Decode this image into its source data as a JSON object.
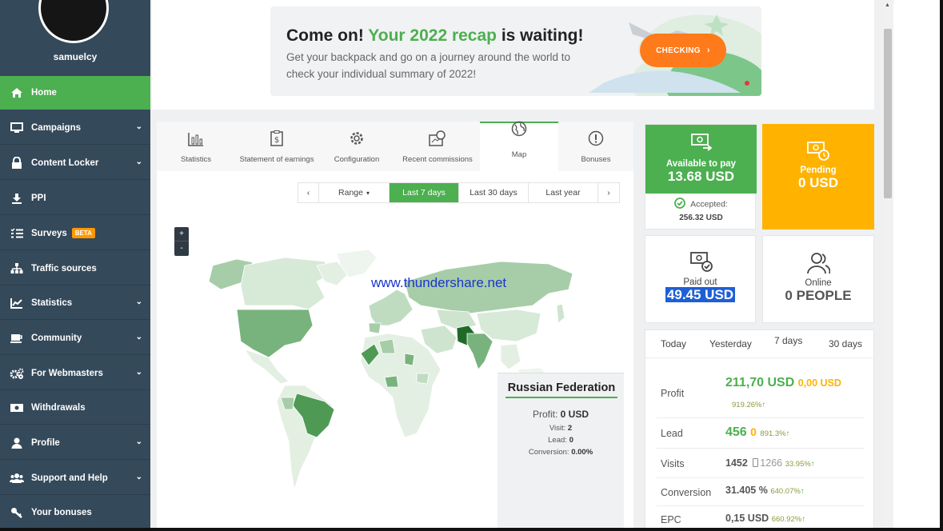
{
  "user": {
    "name": "samuelcy"
  },
  "sidebar": {
    "items": [
      {
        "label": "Home",
        "icon": "home-icon",
        "active": true
      },
      {
        "label": "Campaigns",
        "icon": "monitor-icon",
        "has_submenu": true
      },
      {
        "label": "Content Locker",
        "icon": "lock-icon",
        "has_submenu": true
      },
      {
        "label": "PPI",
        "icon": "download-icon"
      },
      {
        "label": "Surveys",
        "icon": "checklist-icon",
        "badge": "BETA"
      },
      {
        "label": "Traffic sources",
        "icon": "sitemap-icon"
      },
      {
        "label": "Statistics",
        "icon": "line-chart-icon",
        "has_submenu": true
      },
      {
        "label": "Community",
        "icon": "coffee-icon",
        "has_submenu": true
      },
      {
        "label": "For Webmasters",
        "icon": "cogs-icon",
        "has_submenu": true
      },
      {
        "label": "Withdrawals",
        "icon": "money-icon"
      },
      {
        "label": "Profile",
        "icon": "user-icon",
        "has_submenu": true
      },
      {
        "label": "Support and Help",
        "icon": "users-icon",
        "has_submenu": true
      },
      {
        "label": "Your bonuses",
        "icon": "key-icon"
      }
    ]
  },
  "banner": {
    "title_pre": "Come on! ",
    "title_highlight": "Your 2022 recap",
    "title_post": " is waiting!",
    "text": "Get your backpack and go on a journey around the world to check your individual summary of 2022!",
    "button": "CHECKING",
    "button_icon": "chevron-right-icon"
  },
  "tabs": [
    {
      "label": "Statistics",
      "icon": "bar-chart-icon"
    },
    {
      "label": "Statement of earnings",
      "icon": "clipboard-dollar-icon"
    },
    {
      "label": "Configuration",
      "icon": "gear-icon"
    },
    {
      "label": "Recent commissions",
      "icon": "commissions-icon"
    },
    {
      "label": "Map",
      "icon": "globe-icon",
      "active": true
    },
    {
      "label": "Bonuses",
      "icon": "alert-circle-icon"
    }
  ],
  "range": {
    "dropdown": "Range",
    "options": [
      "Last 7 days",
      "Last 30 days",
      "Last year"
    ],
    "selected": "Last 7 days"
  },
  "map": {
    "zoom_in": "+",
    "zoom_out": "-",
    "watermark": "www.thundershare.net"
  },
  "tooltip": {
    "country": "Russian Federation",
    "profit_label": "Profit:",
    "profit_value": "0 USD",
    "visit_label": "Visit:",
    "visit_value": "2",
    "lead_label": "Lead:",
    "lead_value": "0",
    "conversion_label": "Conversion:",
    "conversion_value": "0.00%"
  },
  "cards": {
    "available": {
      "title": "Available to pay",
      "value": "13.68 USD",
      "accepted_label": "Accepted:",
      "accepted_value": "256.32 USD"
    },
    "pending": {
      "title": "Pending",
      "value": "0 USD"
    },
    "paid": {
      "title": "Paid out",
      "value": "49.45 USD"
    },
    "online": {
      "title": "Online",
      "value": "0 PEOPLE"
    }
  },
  "summary": {
    "periods": [
      "Today",
      "Yesterday",
      "7 days",
      "30 days"
    ],
    "active_period": "7 days",
    "rows": {
      "profit": {
        "label": "Profit",
        "value": "211,70 USD",
        "value2": "0,00 USD",
        "pct": "919.26%"
      },
      "lead": {
        "label": "Lead",
        "value": "456",
        "value2": "0",
        "pct": "891.3%"
      },
      "visits": {
        "label": "Visits",
        "value": "1452",
        "value2": "1266",
        "pct": "33.95%"
      },
      "conversion": {
        "label": "Conversion",
        "value": "31.405 %",
        "pct": "640.07%"
      },
      "epc": {
        "label": "EPC",
        "value": "0,15 USD",
        "pct": "660.92%"
      }
    }
  },
  "colors": {
    "accent": "#4caf50",
    "sidebar": "#34495a",
    "pending": "#ffb300",
    "button": "#ff7a1a"
  }
}
